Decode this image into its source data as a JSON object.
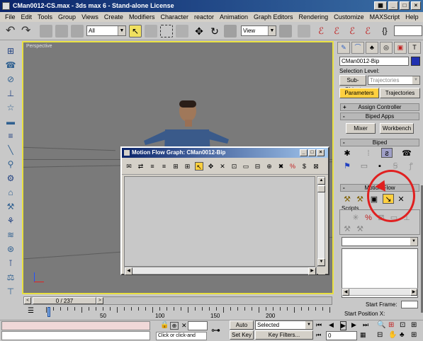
{
  "window": {
    "title": "CMan0012-CS.max - 3ds max 6 - Stand-alone License",
    "controls": [
      "_",
      "□",
      "×"
    ]
  },
  "menu": [
    "File",
    "Edit",
    "Tools",
    "Group",
    "Views",
    "Create",
    "Modifiers",
    "Character",
    "reactor",
    "Animation",
    "Graph Editors",
    "Rendering",
    "Customize",
    "MAXScript",
    "Help"
  ],
  "toolbar": {
    "selection_filter": "All",
    "ref_coord": "View"
  },
  "viewport": {
    "label": "Perspective"
  },
  "motion_flow": {
    "title": "Motion Flow Graph: CMan0012-Bip",
    "tools": [
      "✉",
      "⇄",
      "≡",
      "≡",
      "⊞",
      "⊞",
      "↖",
      "✥",
      "✕",
      "⊡",
      "▭",
      "⊟",
      "⊕",
      "✖",
      "%",
      "$",
      "⊠"
    ]
  },
  "command_panel": {
    "object_name": "CMan0012-Bip",
    "selection_level_label": "Selection Level:",
    "sub_object_label": "Sub-Object",
    "sub_object_value": "Trajectories",
    "tab_parameters": "Parameters",
    "tab_trajectories": "Trajectories",
    "rollout_assign": "Assign Controller",
    "rollout_biped_apps": "Biped Apps",
    "mixer_button": "Mixer",
    "workbench_button": "Workbench",
    "rollout_biped": "Biped",
    "rollout_motion_flow": "Motion Flow",
    "scripts_label": "Scripts",
    "start_frame_label": "Start Frame:",
    "start_position_label": "Start Position X:",
    "accent_color": "#ffd040",
    "highlight_circle_color": "#e02020"
  },
  "timeline": {
    "frame_display": "0 / 237",
    "ruler_labels": [
      "50",
      "100",
      "150",
      "200"
    ]
  },
  "status": {
    "hint": "Click or click-and",
    "auto_key": "Auto Key",
    "set_key": "Set Key",
    "selected": "Selected",
    "key_filters": "Key Filters...",
    "frame_field": "0"
  }
}
